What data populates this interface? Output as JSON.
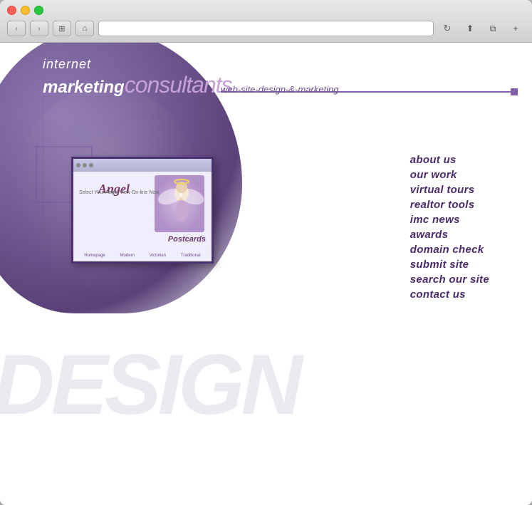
{
  "browser": {
    "address": "",
    "back_label": "‹",
    "forward_label": "›",
    "window_label": "⊞",
    "home_label": "⌂",
    "refresh_label": "↻",
    "share_label": "⬆",
    "tabs_label": "⧉",
    "plus_label": "+"
  },
  "header": {
    "internet_label": "internet",
    "marketing_label": "marketing",
    "consultants_label": "consultants",
    "tagline": "web-site-design-&-marketing"
  },
  "nav": {
    "items": [
      {
        "label": "about us",
        "id": "about-us"
      },
      {
        "label": "our work",
        "id": "our-work"
      },
      {
        "label": "virtual tours",
        "id": "virtual-tours"
      },
      {
        "label": "realtor tools",
        "id": "realtor-tools"
      },
      {
        "label": "imc news",
        "id": "imc-news"
      },
      {
        "label": "awards",
        "id": "awards"
      },
      {
        "label": "domain check",
        "id": "domain-check"
      },
      {
        "label": "submit site",
        "id": "submit-site"
      },
      {
        "label": "search our site",
        "id": "search-our-site"
      },
      {
        "label": "contact us",
        "id": "contact-us"
      }
    ]
  },
  "screenshot": {
    "title": "Angel Postcards",
    "select_text": "Select Your Angel\nView On-line Now",
    "postcards_label": "Postcards",
    "nav_items": [
      "Homepage",
      "Modern",
      "Victorian",
      "Traditional"
    ]
  },
  "design_bg": "DESIGN"
}
